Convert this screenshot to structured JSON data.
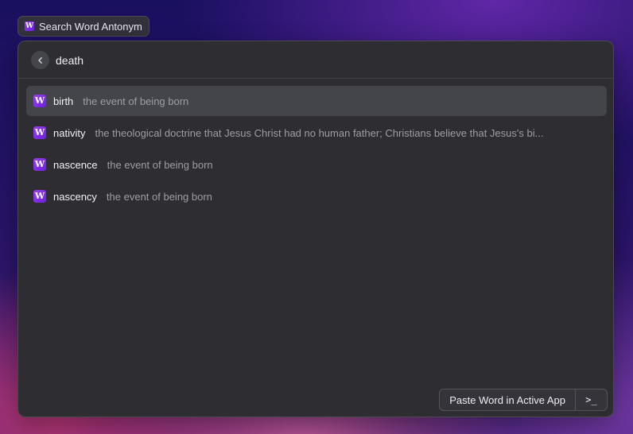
{
  "extension": {
    "icon": "W",
    "title": "Search Word Antonym"
  },
  "search": {
    "query": "death"
  },
  "results": [
    {
      "icon": "W",
      "word": "birth",
      "definition": "the event of being born"
    },
    {
      "icon": "W",
      "word": "nativity",
      "definition": "the theological doctrine that Jesus Christ had no human father; Christians believe that Jesus's bi..."
    },
    {
      "icon": "W",
      "word": "nascence",
      "definition": "the event of being born"
    },
    {
      "icon": "W",
      "word": "nascency",
      "definition": "the event of being born"
    }
  ],
  "actions": {
    "primary_label": "Paste Word in Active App",
    "shortcut_glyph": ">_"
  },
  "colors": {
    "icon_purple": "#7c2fe4",
    "panel_bg": "#2d2d32",
    "selected_row": "#44444b"
  }
}
